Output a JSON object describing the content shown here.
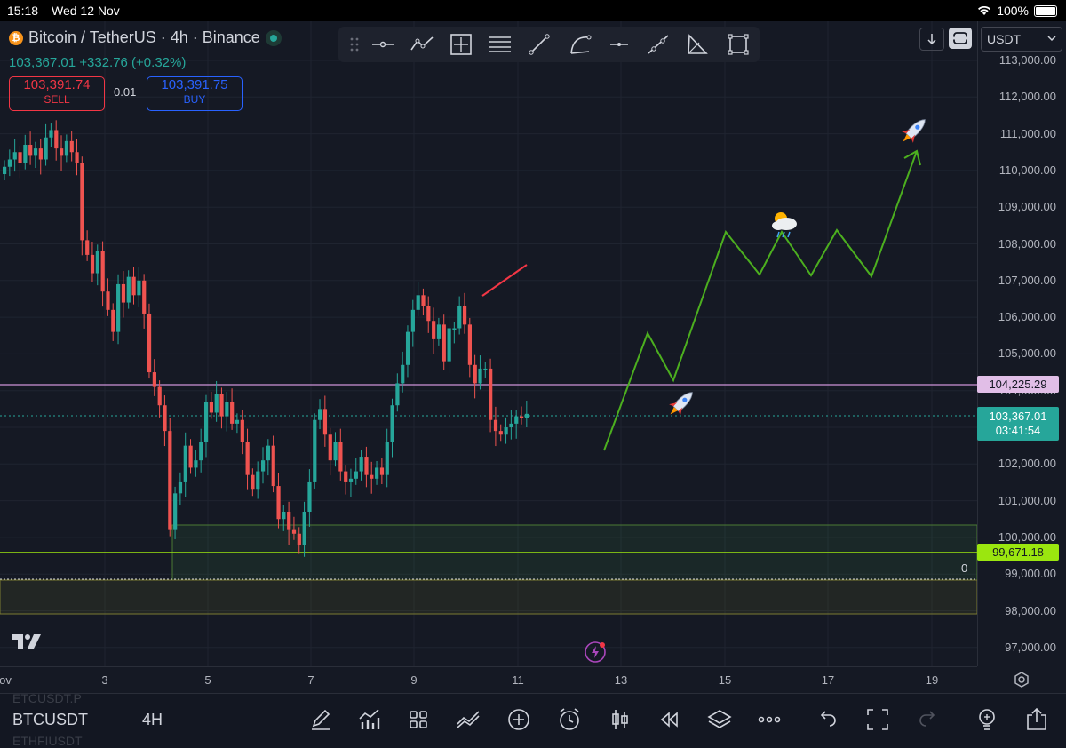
{
  "status_bar": {
    "time": "15:18",
    "date": "Wed 12 Nov",
    "battery": "100%"
  },
  "header": {
    "symbol_title": "Bitcoin / TetherUS · 4h · Binance",
    "last_price": "103,367.01",
    "change": "+332.76 (+0.32%)",
    "sell_price": "103,391.74",
    "sell_label": "SELL",
    "buy_price": "103,391.75",
    "buy_label": "BUY",
    "lot_size": "0.01"
  },
  "currency_select": {
    "value": "USDT"
  },
  "price_axis": {
    "labels": [
      "113,000.00",
      "112,000.00",
      "111,000.00",
      "110,000.00",
      "109,000.00",
      "108,000.00",
      "107,000.00",
      "106,000.00",
      "105,000.00",
      "104,000.00",
      "103,000.00",
      "102,000.00",
      "101,000.00",
      "100,000.00",
      "99,000.00",
      "98,000.00",
      "97,000.00"
    ],
    "tag_resistance": "104,225.29",
    "tag_current_price": "103,367.01",
    "tag_countdown": "03:41:54",
    "tag_support": "99,671.18"
  },
  "time_axis": {
    "labels": [
      "ov",
      "3",
      "5",
      "7",
      "9",
      "11",
      "13",
      "15",
      "17",
      "19"
    ]
  },
  "zone_label": "0",
  "bottom_bar": {
    "symbol": "BTCUSDT",
    "interval": "4H",
    "watchlist_prev": "ETCUSDT.P",
    "watchlist_next": "ETHFIUSDT"
  },
  "colors": {
    "up": "#26a69a",
    "down": "#ef5350",
    "resistance": "#ce93d8",
    "support": "#9be60f",
    "projection": "#4caf1f"
  }
}
